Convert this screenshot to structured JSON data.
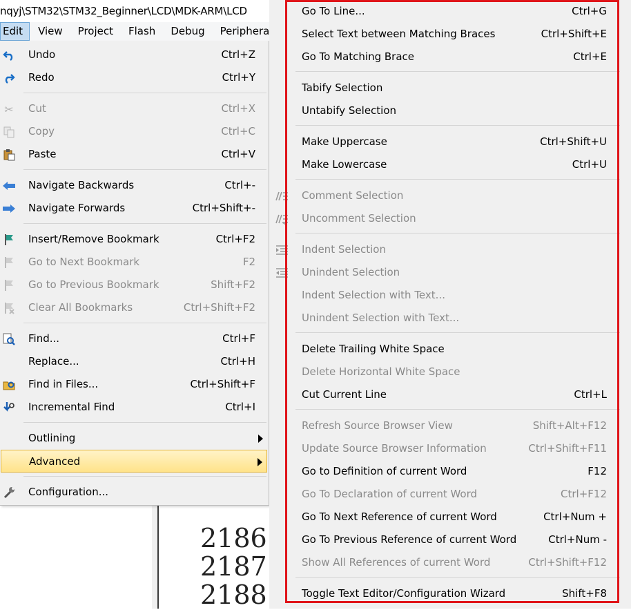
{
  "window": {
    "title": "nqyj\\STM32\\STM32_Beginner\\LCD\\MDK-ARM\\LCD"
  },
  "menubar": [
    "Edit",
    "View",
    "Project",
    "Flash",
    "Debug",
    "Peripheral"
  ],
  "edit_menu": {
    "items": [
      {
        "label": "Undo",
        "shortcut": "Ctrl+Z",
        "icon": "undo-icon",
        "enabled": true
      },
      {
        "label": "Redo",
        "shortcut": "Ctrl+Y",
        "icon": "redo-icon",
        "enabled": true
      },
      {
        "label": "Cut",
        "shortcut": "Ctrl+X",
        "icon": "cut-icon",
        "enabled": false
      },
      {
        "label": "Copy",
        "shortcut": "Ctrl+C",
        "icon": "copy-icon",
        "enabled": false
      },
      {
        "label": "Paste",
        "shortcut": "Ctrl+V",
        "icon": "paste-icon",
        "enabled": true
      },
      {
        "label": "Navigate Backwards",
        "shortcut": "Ctrl+-",
        "icon": "arrow-left-icon",
        "enabled": true
      },
      {
        "label": "Navigate Forwards",
        "shortcut": "Ctrl+Shift+-",
        "icon": "arrow-right-icon",
        "enabled": true
      },
      {
        "label": "Insert/Remove Bookmark",
        "shortcut": "Ctrl+F2",
        "icon": "bookmark-flag-icon",
        "enabled": true
      },
      {
        "label": "Go to Next Bookmark",
        "shortcut": "F2",
        "icon": "next-bookmark-icon",
        "enabled": false
      },
      {
        "label": "Go to Previous Bookmark",
        "shortcut": "Shift+F2",
        "icon": "previous-bookmark-icon",
        "enabled": false
      },
      {
        "label": "Clear All Bookmarks",
        "shortcut": "Ctrl+Shift+F2",
        "icon": "clear-bookmarks-icon",
        "enabled": false
      },
      {
        "label": "Find...",
        "shortcut": "Ctrl+F",
        "icon": "find-icon",
        "enabled": true
      },
      {
        "label": "Replace...",
        "shortcut": "Ctrl+H",
        "icon": "",
        "enabled": true
      },
      {
        "label": "Find in Files...",
        "shortcut": "Ctrl+Shift+F",
        "icon": "find-in-files-icon",
        "enabled": true
      },
      {
        "label": "Incremental Find",
        "shortcut": "Ctrl+I",
        "icon": "incremental-find-icon",
        "enabled": true
      },
      {
        "label": "Outlining",
        "shortcut": "",
        "icon": "",
        "enabled": true,
        "submenu": true
      },
      {
        "label": "Advanced",
        "shortcut": "",
        "icon": "",
        "enabled": true,
        "submenu": true,
        "highlighted": true
      },
      {
        "label": "Configuration...",
        "shortcut": "",
        "icon": "wrench-icon",
        "enabled": true
      }
    ]
  },
  "advanced_menu": {
    "items": [
      {
        "label": "Go To Line...",
        "shortcut": "Ctrl+G",
        "enabled": true
      },
      {
        "label": "Select Text between Matching Braces",
        "shortcut": "Ctrl+Shift+E",
        "enabled": true
      },
      {
        "label": "Go To Matching Brace",
        "shortcut": "Ctrl+E",
        "enabled": true
      },
      {
        "label": "Tabify Selection",
        "shortcut": "",
        "enabled": true
      },
      {
        "label": "Untabify Selection",
        "shortcut": "",
        "enabled": true
      },
      {
        "label": "Make Uppercase",
        "shortcut": "Ctrl+Shift+U",
        "enabled": true
      },
      {
        "label": "Make Lowercase",
        "shortcut": "Ctrl+U",
        "enabled": true
      },
      {
        "label": "Comment Selection",
        "shortcut": "",
        "enabled": false,
        "icon": "comment-icon"
      },
      {
        "label": "Uncomment Selection",
        "shortcut": "",
        "enabled": false,
        "icon": "uncomment-icon"
      },
      {
        "label": "Indent Selection",
        "shortcut": "",
        "enabled": false,
        "icon": "indent-icon"
      },
      {
        "label": "Unindent Selection",
        "shortcut": "",
        "enabled": false,
        "icon": "unindent-icon"
      },
      {
        "label": "Indent Selection with Text...",
        "shortcut": "",
        "enabled": false
      },
      {
        "label": "Unindent Selection with Text...",
        "shortcut": "",
        "enabled": false
      },
      {
        "label": "Delete Trailing White Space",
        "shortcut": "",
        "enabled": true
      },
      {
        "label": "Delete Horizontal White Space",
        "shortcut": "",
        "enabled": false
      },
      {
        "label": "Cut Current Line",
        "shortcut": "Ctrl+L",
        "enabled": true
      },
      {
        "label": "Refresh Source Browser View",
        "shortcut": "Shift+Alt+F12",
        "enabled": false
      },
      {
        "label": "Update Source Browser Information",
        "shortcut": "Ctrl+Shift+F11",
        "enabled": false
      },
      {
        "label": "Go to Definition of current Word",
        "shortcut": "F12",
        "enabled": true
      },
      {
        "label": "Go To Declaration of current Word",
        "shortcut": "Ctrl+F12",
        "enabled": false
      },
      {
        "label": "Go To Next Reference of current Word",
        "shortcut": "Ctrl+Num +",
        "enabled": true
      },
      {
        "label": "Go To Previous Reference of current Word",
        "shortcut": "Ctrl+Num -",
        "enabled": true
      },
      {
        "label": "Show All References of current Word",
        "shortcut": "Ctrl+Shift+F12",
        "enabled": false
      },
      {
        "label": "Toggle Text Editor/Configuration Wizard",
        "shortcut": "Shift+F8",
        "enabled": true
      }
    ]
  },
  "editor": {
    "line_numbers": [
      "2186",
      "2187",
      "2188"
    ]
  },
  "colors": {
    "highlight_border": "#e2b43a",
    "annotation_frame": "#e0151a",
    "menu_bg": "#f0f0f0"
  }
}
